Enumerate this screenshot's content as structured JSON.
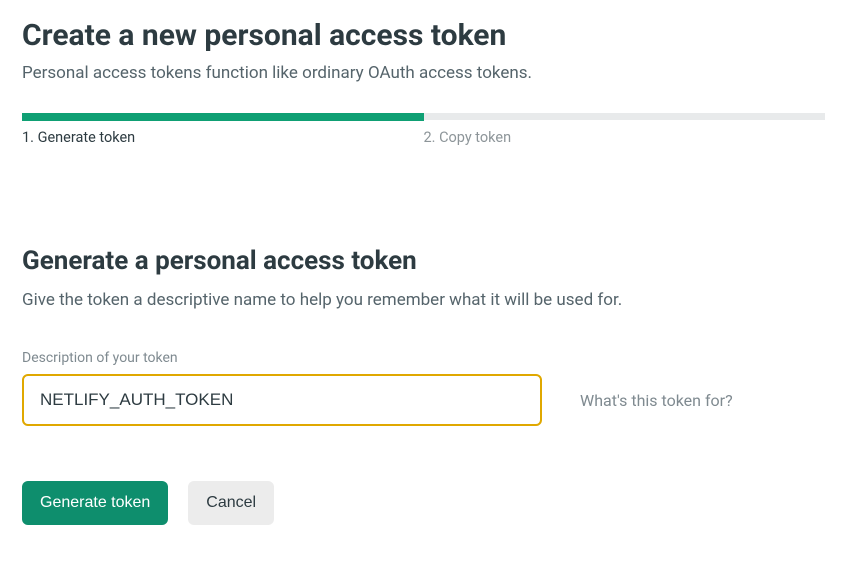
{
  "header": {
    "title": "Create a new personal access token",
    "subtitle": "Personal access tokens function like ordinary OAuth access tokens."
  },
  "steps": [
    {
      "label": "1. Generate token",
      "active": true
    },
    {
      "label": "2. Copy token",
      "active": false
    }
  ],
  "form": {
    "section_title": "Generate a personal access token",
    "section_desc": "Give the token a descriptive name to help you remember what it will be used for.",
    "field_label": "Description of your token",
    "token_value": "NETLIFY_AUTH_TOKEN",
    "field_hint": "What's this token for?",
    "generate_label": "Generate token",
    "cancel_label": "Cancel"
  },
  "colors": {
    "accent": "#0fa074",
    "input_border_active": "#e0a800"
  }
}
